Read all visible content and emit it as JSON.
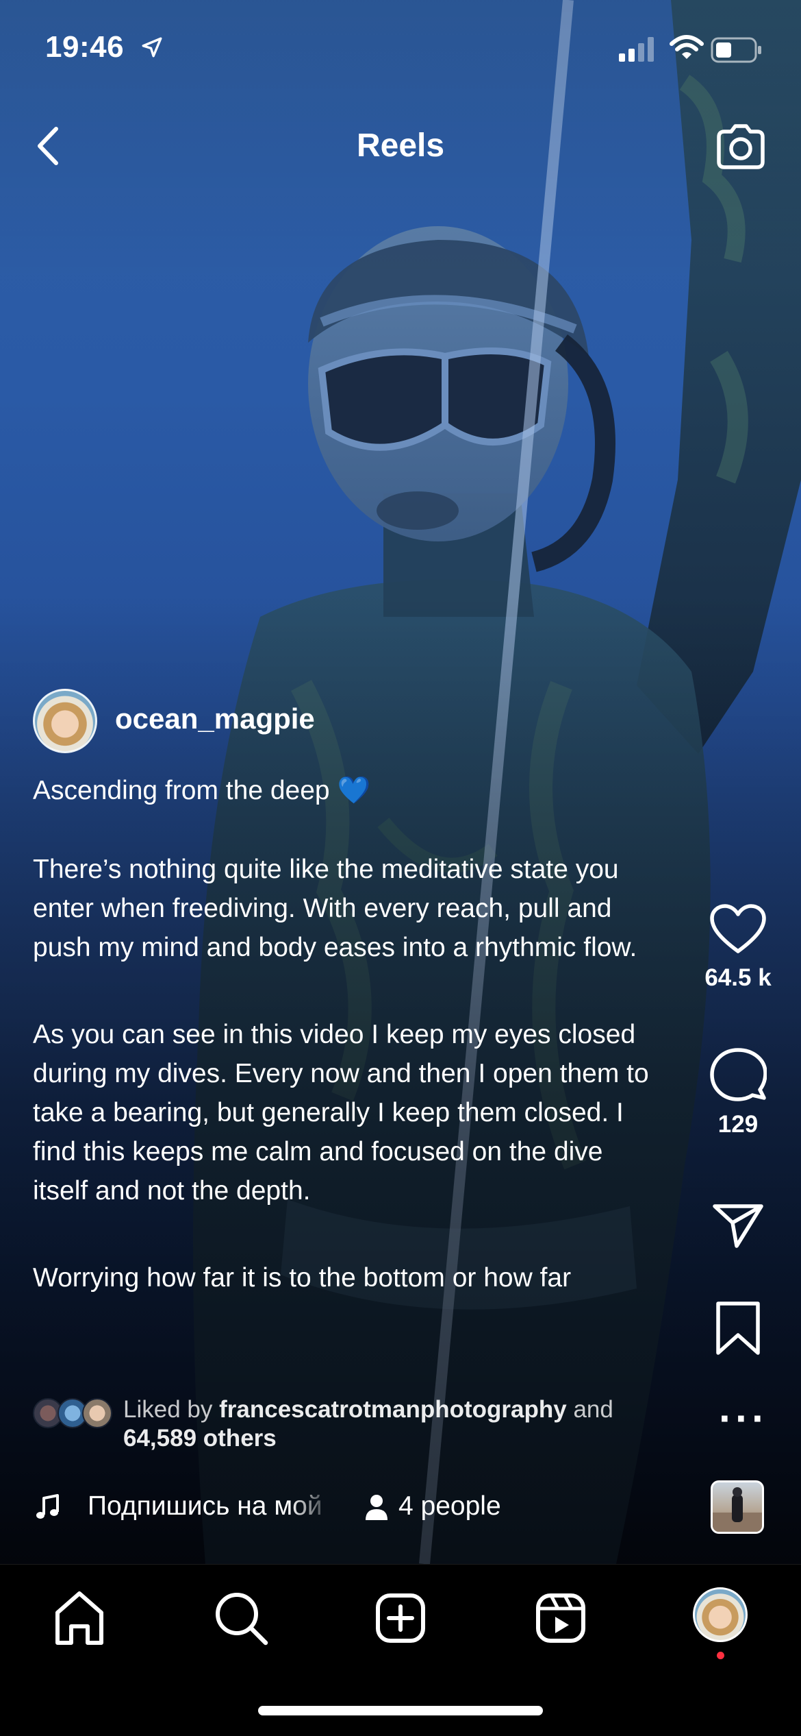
{
  "status_bar": {
    "time": "19:46"
  },
  "header": {
    "title": "Reels"
  },
  "post": {
    "username": "ocean_magpie",
    "caption": {
      "title": "Ascending from the deep",
      "emoji": "💙",
      "paragraph1": "There’s nothing quite like the meditative state you enter when freediving. With every reach, pull and push my mind and body eases into a rhythmic flow.",
      "paragraph2": "As you can see in this video I keep my eyes closed during my dives. Every now and then I open them to take a bearing, but generally I keep them closed. I find this keeps me calm and focused on the dive itself and not the depth.",
      "paragraph3": "Worrying how far it is to the bottom or how far"
    },
    "liked_by": {
      "prefix": "Liked by",
      "user": "francescatrotmanphotography",
      "and": "and",
      "others": "64,589 others"
    },
    "audio": {
      "track": "Подпишись на мой",
      "people": "4 people"
    }
  },
  "actions": {
    "likes": "64.5 k",
    "comments": "129"
  },
  "icons": {
    "location": "location-arrow-icon",
    "signal": "signal-icon",
    "wifi": "wifi-icon",
    "battery": "battery-icon",
    "back": "chevron-left-icon",
    "camera": "camera-icon",
    "like": "heart-icon",
    "comment": "comment-icon",
    "share": "send-icon",
    "save": "bookmark-icon",
    "more": "more-icon",
    "music": "music-note-icon",
    "people": "person-icon",
    "home": "home-icon",
    "search": "search-icon",
    "create": "add-post-icon",
    "reels": "reels-icon"
  },
  "colors": {
    "video_top": "#2f5fa4",
    "video_bottom": "#070d1c",
    "heart_emoji": "#3a7bff",
    "notification_dot": "#ff3040",
    "nav_background": "#000000"
  }
}
